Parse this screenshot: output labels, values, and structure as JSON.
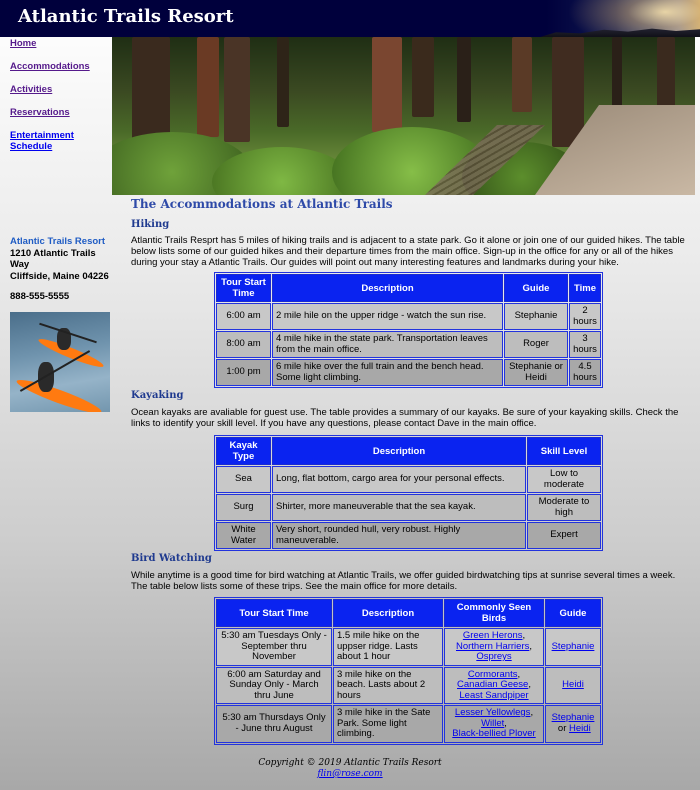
{
  "site_title": "Atlantic Trails Resort",
  "nav": [
    {
      "label": "Home"
    },
    {
      "label": "Accommodations"
    },
    {
      "label": "Activities"
    },
    {
      "label": "Reservations"
    },
    {
      "label": "Entertainment Schedule"
    }
  ],
  "address": {
    "name": "Atlantic Trails Resort",
    "street": "1210 Atlantic Trails Way",
    "city": "Cliffside, Maine 04226",
    "phone": "888-555-5555"
  },
  "page_heading": "The Accommodations at Atlantic Trails",
  "hiking": {
    "heading": "Hiking",
    "intro": "Atlantic Trails Resprt has 5 miles of hiking trails and is adjacent to a state park. Go it alone or join one of our guided hikes. The table below lists some of our guided hikes and their departure times from the main office. Sign-up in the office for any or all of the hikes during your stay a Atlantic Trails. Our guides will point out many interesting features and landmarks during your hike.",
    "headers": [
      "Tour Start Time",
      "Description",
      "Guide",
      "Time"
    ],
    "rows": [
      [
        "6:00 am",
        "2 mile hile on the upper ridge - watch the sun rise.",
        "Stephanie",
        "2 hours"
      ],
      [
        "8:00 am",
        "4 mile hike in the state park. Transportation leaves from the main office.",
        "Roger",
        "3 hours"
      ],
      [
        "1:00 pm",
        "6 mile hike over the full train and the bench head. Some light climbing.",
        "Stephanie or Heidi",
        "4.5 hours"
      ]
    ]
  },
  "kayaking": {
    "heading": "Kayaking",
    "intro": "Ocean kayaks are avaliable for guest use. The table provides a summary of our kayaks. Be sure of your kayaking skills. Check the links to identify your skill level. If you have any questions, please contact Dave in the main office.",
    "headers": [
      "Kayak Type",
      "Description",
      "Skill Level"
    ],
    "rows": [
      [
        "Sea",
        "Long, flat bottom, cargo area for your personal effects.",
        "Low to moderate"
      ],
      [
        "Surg",
        "Shirter, more maneuverable that the sea kayak.",
        "Moderate to high"
      ],
      [
        "White Water",
        "Very short, rounded hull, very robust. Highly maneuverable.",
        "Expert"
      ]
    ]
  },
  "birding": {
    "heading": "Bird Watching",
    "intro": "While anytime is a good time for bird watching at Atlantic Trails, we offer guided birdwatching tips at sunrise several times a week. The table below lists some of these trips. See the main office for more details.",
    "headers": [
      "Tour Start Time",
      "Description",
      "Commonly Seen Birds",
      "Guide"
    ],
    "rows": [
      {
        "time": "5:30 am Tuesdays Only - September thru November",
        "desc": "1.5 mile hike on the uppser ridge. Lasts about 1 hour",
        "birds": [
          "Green Herons",
          "Northern Harriers",
          "Ospreys"
        ],
        "guide": "Stephanie"
      },
      {
        "time": "6:00 am Saturday and Sunday Only - March thru June",
        "desc": "3 mile hike on the beach. Lasts about 2 hours",
        "birds": [
          "Cormorants",
          "Canadian Geese",
          "Least Sandpiper"
        ],
        "guide": "Heidi"
      },
      {
        "time": "5:30 am Thursdays Only - June thru August",
        "desc": "3 mile hike in the Sate Park. Some light climbing.",
        "birds": [
          "Lesser Yellowlegs",
          "Willet",
          "Black-bellied Plover"
        ],
        "guide_a": "Stephanie",
        "guide_sep": " or ",
        "guide_b": "Heidi"
      }
    ]
  },
  "footer": {
    "copyright": "Copyright © 2019 Atlantic Trails Resort",
    "email": "flin@rose.com"
  }
}
